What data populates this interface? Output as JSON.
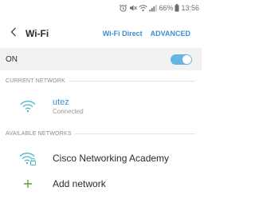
{
  "status_bar": {
    "battery_percent": "66%",
    "time": "13:56"
  },
  "app_bar": {
    "title": "Wi-Fi",
    "wifi_direct_label": "Wi-Fi Direct",
    "advanced_label": "ADVANCED"
  },
  "wifi_toggle": {
    "label": "ON",
    "enabled": true
  },
  "current_network": {
    "section_title": "CURRENT NETWORK",
    "name": "utez",
    "status": "Connected"
  },
  "available_networks": {
    "section_title": "AVAILABLE NETWORKS",
    "items": [
      {
        "name": "Cisco Networking Academy",
        "icon": "wifi-locked-icon"
      }
    ],
    "add_network_label": "Add network"
  },
  "colors": {
    "accent": "#3e8ed0",
    "toggle_on": "#62b5e5",
    "wifi_icon": "#4bb8c7",
    "add_icon": "#5aa13b"
  }
}
